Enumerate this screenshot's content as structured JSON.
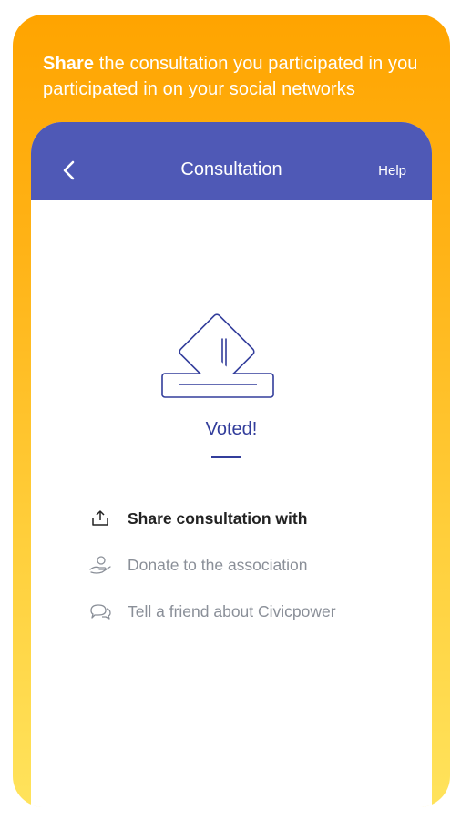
{
  "promo": {
    "caption_bold": "Share",
    "caption_rest": " the consultation you participated in you participated in on your social networks"
  },
  "header": {
    "back_icon": "chevron-left-icon",
    "title": "Consultation",
    "help_label": "Help"
  },
  "status": {
    "illustration": "ballot-box-icon",
    "label": "Voted!"
  },
  "actions": [
    {
      "icon": "share-icon",
      "label": "Share consultation with"
    },
    {
      "icon": "donate-hand-icon",
      "label": "Donate to the association"
    },
    {
      "icon": "chat-bubbles-icon",
      "label": "Tell a friend about Civicpower"
    }
  ],
  "colors": {
    "header_bg": "#4f59b6",
    "accent_text": "#323d9b",
    "promo_gradient_top": "#ffa400",
    "promo_gradient_bottom": "#ffe35c"
  }
}
